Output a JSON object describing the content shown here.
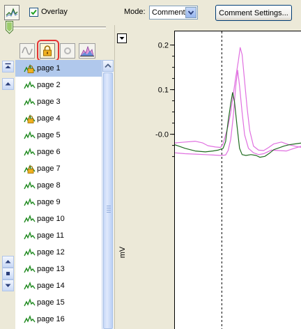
{
  "toolbar": {
    "overlay_label": "Overlay",
    "overlay_checked": true,
    "mode_label": "Mode:",
    "mode_value": "Comment",
    "comment_settings_label": "Comment Settings..."
  },
  "pages": [
    {
      "label": "page 1",
      "locked": true,
      "selected": true
    },
    {
      "label": "page 2",
      "locked": false,
      "selected": false
    },
    {
      "label": "page 3",
      "locked": false,
      "selected": false
    },
    {
      "label": "page 4",
      "locked": true,
      "selected": false
    },
    {
      "label": "page 5",
      "locked": false,
      "selected": false
    },
    {
      "label": "page 6",
      "locked": false,
      "selected": false
    },
    {
      "label": "page 7",
      "locked": true,
      "selected": false
    },
    {
      "label": "page 8",
      "locked": false,
      "selected": false
    },
    {
      "label": "page 9",
      "locked": false,
      "selected": false
    },
    {
      "label": "page 10",
      "locked": false,
      "selected": false
    },
    {
      "label": "page 11",
      "locked": false,
      "selected": false
    },
    {
      "label": "page 12",
      "locked": false,
      "selected": false
    },
    {
      "label": "page 13",
      "locked": false,
      "selected": false
    },
    {
      "label": "page 14",
      "locked": false,
      "selected": false
    },
    {
      "label": "page 15",
      "locked": false,
      "selected": false
    },
    {
      "label": "page 16",
      "locked": false,
      "selected": false
    }
  ],
  "colors": {
    "selection": "#b0c8ec",
    "trace_green": "#1f6b1f",
    "trace_pink": "#e070e0",
    "lock_highlight": "#e53333"
  },
  "icons": {
    "toolbar": "waveform-overlay-icon",
    "mini_buttons": [
      "wave-icon",
      "lock-icon",
      "circle-icon",
      "spectrum-icon"
    ],
    "page_row": "trace-icon",
    "page_row_locked": "locked-trace-icon"
  },
  "chart_data": {
    "type": "line",
    "ylabel": "mV",
    "y_ticks": [
      "0.2",
      "0.1",
      "-0.0"
    ],
    "y_tick_values": [
      0.2,
      0.1,
      0.0
    ],
    "ylim": [
      -0.07,
      0.23
    ],
    "xlim": [
      0,
      100
    ],
    "marker_x": 37,
    "series": [
      {
        "color": "#1f6b1f",
        "points": [
          [
            0,
            -0.022
          ],
          [
            8,
            -0.03
          ],
          [
            16,
            -0.036
          ],
          [
            24,
            -0.038
          ],
          [
            30,
            -0.036
          ],
          [
            34,
            -0.034
          ],
          [
            38,
            -0.03
          ],
          [
            40,
            -0.015
          ],
          [
            42,
            0.03
          ],
          [
            44,
            0.07
          ],
          [
            45.5,
            0.095
          ],
          [
            47,
            0.075
          ],
          [
            49,
            0.02
          ],
          [
            51,
            -0.03
          ],
          [
            53,
            -0.044
          ],
          [
            56,
            -0.046
          ],
          [
            60,
            -0.044
          ],
          [
            64,
            -0.046
          ],
          [
            67,
            -0.05
          ],
          [
            71,
            -0.048
          ],
          [
            75,
            -0.04
          ],
          [
            78,
            -0.033
          ],
          [
            82,
            -0.029
          ],
          [
            86,
            -0.025
          ],
          [
            90,
            -0.022
          ],
          [
            95,
            -0.02
          ],
          [
            100,
            -0.018
          ]
        ]
      },
      {
        "color": "#e070e0",
        "points": [
          [
            0,
            -0.018
          ],
          [
            8,
            -0.016
          ],
          [
            16,
            -0.014
          ],
          [
            22,
            -0.018
          ],
          [
            26,
            -0.024
          ],
          [
            32,
            -0.027
          ],
          [
            36,
            -0.028
          ],
          [
            38,
            -0.02
          ],
          [
            40,
            0.0
          ],
          [
            42,
            0.02
          ],
          [
            44,
            0.05
          ],
          [
            46,
            0.09
          ],
          [
            48,
            0.13
          ],
          [
            50,
            0.165
          ],
          [
            51.5,
            0.196
          ],
          [
            53,
            0.18
          ],
          [
            55,
            0.12
          ],
          [
            57,
            0.06
          ],
          [
            59,
            0.01
          ],
          [
            62,
            -0.025
          ],
          [
            66,
            -0.034
          ],
          [
            70,
            -0.035
          ],
          [
            74,
            -0.028
          ],
          [
            78,
            -0.02
          ],
          [
            84,
            -0.016
          ],
          [
            90,
            -0.022
          ],
          [
            96,
            -0.026
          ],
          [
            100,
            -0.028
          ]
        ]
      },
      {
        "color": "#e070e0",
        "points": [
          [
            0,
            -0.04
          ],
          [
            8,
            -0.042
          ],
          [
            16,
            -0.043
          ],
          [
            24,
            -0.044
          ],
          [
            30,
            -0.045
          ],
          [
            36,
            -0.046
          ],
          [
            40,
            -0.045
          ],
          [
            42,
            -0.035
          ],
          [
            44,
            -0.01
          ],
          [
            46,
            0.04
          ],
          [
            48,
            0.11
          ],
          [
            49.5,
            0.145
          ],
          [
            51,
            0.11
          ],
          [
            53,
            0.05
          ],
          [
            55,
            0.0
          ],
          [
            58,
            -0.03
          ],
          [
            62,
            -0.04
          ],
          [
            66,
            -0.044
          ],
          [
            70,
            -0.042
          ],
          [
            76,
            -0.034
          ],
          [
            82,
            -0.035
          ],
          [
            88,
            -0.036
          ],
          [
            94,
            -0.03
          ],
          [
            100,
            -0.025
          ]
        ]
      }
    ]
  }
}
